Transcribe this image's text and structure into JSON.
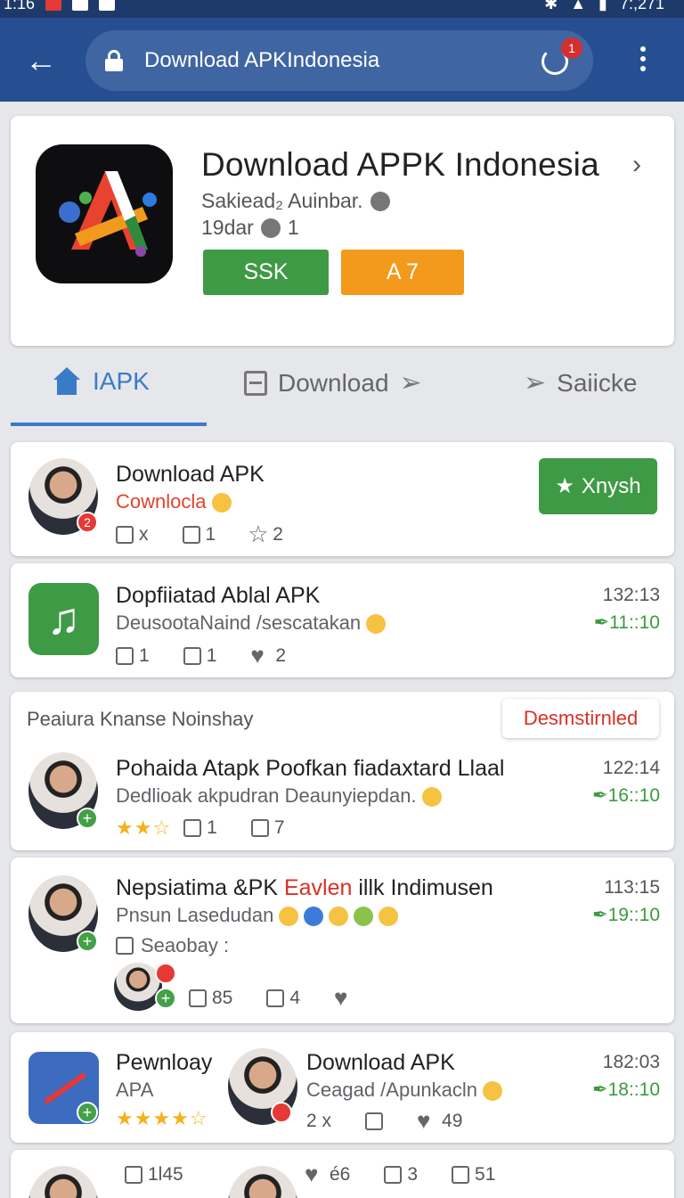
{
  "status_bar": {
    "time": "1:16",
    "right_text": "7:,271"
  },
  "browser": {
    "url": "Download APKIndonesia",
    "notification_count": "1"
  },
  "app": {
    "title": "Download APPK Indonesia",
    "subtitle": "Sakiead₂ Auinbar.",
    "meta_date": "19dar",
    "meta_count": "1",
    "button_primary": "SSK",
    "button_secondary": "A 7"
  },
  "tabs": [
    {
      "label": "IAPK"
    },
    {
      "label": "Download"
    },
    {
      "label": "Saiicke"
    }
  ],
  "feed": [
    {
      "title": "Download APK",
      "subtitle": "Cownlocla",
      "badge": "2",
      "follow_label": "Xnysh",
      "likes": "x",
      "comments": "1",
      "stars": "2"
    },
    {
      "title": "Dopfiiatad Ablal APK",
      "subtitle": "DeusootaNaind /sescatakan",
      "time": "132:13",
      "time2": "★★★",
      "time2_text": "✒11::10",
      "comments": "1",
      "likes": "1",
      "hearts": "2"
    },
    {
      "section": "Peaiura Knanse Noinshay",
      "tooltip": "Desmstirnled",
      "title": "Pohaida Atapk Poofkan fiadaxtard Llaal",
      "subtitle": "Dedlioak akpudran Deaunyiepdan.",
      "time": "122:14",
      "time2_text": "✒16::10",
      "likes": "1",
      "comments": "7"
    },
    {
      "title_a": "Nepsiatima &PK ",
      "title_b": "Eavlen",
      "title_c": " illk Indimusen",
      "subtitle": "Pnsun Lasedudan",
      "checkbox_label": "Seaobay :",
      "time": "113:15",
      "time2_text": "✒19::10",
      "likes": "85",
      "shares": "4"
    },
    {
      "title": "Pewnloay",
      "subtitle": "APA",
      "title2": "Download APK",
      "subtitle2": "Ceagad /Apunkacln",
      "time": "182:03",
      "time2_text": "✒18::10",
      "count_a": "2 x",
      "hearts": "49"
    },
    {
      "home_count": "1l45",
      "count_a": "é6",
      "count_b": "3",
      "count_c": "51"
    }
  ]
}
